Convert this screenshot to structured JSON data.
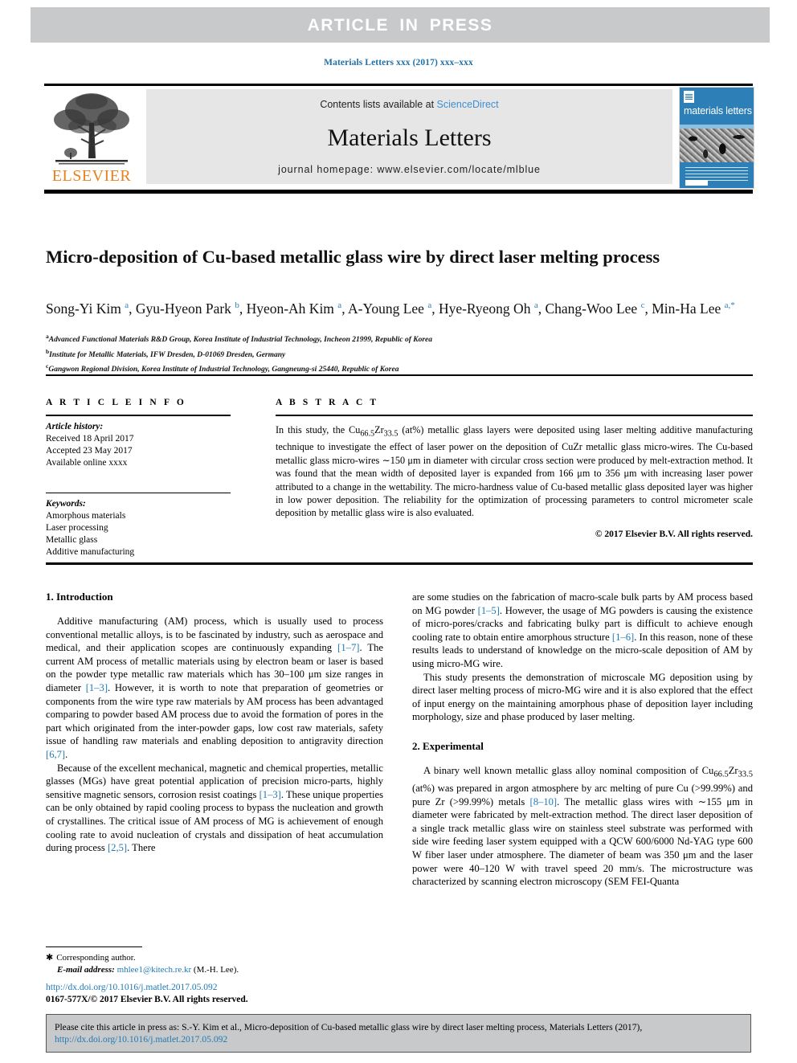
{
  "banner": {
    "text": "ARTICLE  IN  PRESS"
  },
  "running_head": {
    "text": "Materials Letters xxx (2017) xxx–xxx"
  },
  "masthead": {
    "contents_prefix": "Contents lists available at ",
    "sciencedirect": "ScienceDirect",
    "journal_name": "Materials Letters",
    "homepage": "journal homepage: www.elsevier.com/locate/mlblue",
    "publisher_wordmark": "ELSEVIER",
    "cover_title": "materials letters"
  },
  "article": {
    "title": "Micro-deposition of Cu-based metallic glass wire by direct laser melting process",
    "authors_html": "Song-Yi Kim <sup>a</sup>, Gyu-Hyeon Park <sup>b</sup>, Hyeon-Ah Kim <sup>a</sup>, A-Young Lee <sup>a</sup>, Hye-Ryeong Oh <sup>a</sup>, Chang-Woo Lee <sup>c</sup>, Min-Ha Lee <sup>a,*</sup>",
    "affiliations": [
      {
        "mark": "a",
        "text": "Advanced Functional Materials R&D Group, Korea Institute of Industrial Technology, Incheon 21999, Republic of Korea"
      },
      {
        "mark": "b",
        "text": "Institute for Metallic Materials, IFW Dresden, D-01069 Dresden, Germany"
      },
      {
        "mark": "c",
        "text": "Gangwon Regional Division, Korea Institute of Industrial Technology, Gangneung-si 25440, Republic of Korea"
      }
    ]
  },
  "info": {
    "heading": "A R T I C L E    I N F O",
    "history_label": "Article history:",
    "history": [
      "Received 18 April 2017",
      "Accepted 23 May 2017",
      "Available online xxxx"
    ],
    "keywords_label": "Keywords:",
    "keywords": [
      "Amorphous materials",
      "Laser processing",
      "Metallic glass",
      "Additive manufacturing"
    ]
  },
  "abstract": {
    "heading": "A B S T R A C T",
    "text_html": "In this study, the Cu<sub>66.5</sub>Zr<sub>33.5</sub> (at%) metallic glass layers were deposited using laser melting additive manufacturing technique to investigate the effect of laser power on the deposition of CuZr metallic glass micro-wires. The Cu-based metallic glass micro-wires &sim;150 &mu;m in diameter with circular cross section were produced by melt-extraction method. It was found that the mean width of deposited layer is expanded from 166 &mu;m to 356 &mu;m with increasing laser power attributed to a change in the wettability. The micro-hardness value of Cu-based metallic glass deposited layer was higher in low power deposition. The reliability for the optimization of processing parameters to control micrometer scale deposition by metallic glass wire is also evaluated.",
    "copyright": "© 2017 Elsevier B.V. All rights reserved."
  },
  "body": {
    "intro_heading": "1. Introduction",
    "experimental_heading": "2. Experimental",
    "left_paragraphs_html": [
      "Additive manufacturing (AM) process, which is usually used to process conventional metallic alloys, is to be fascinated by industry, such as aerospace and medical, and their application scopes are continuously expanding <span class=\"ref\">[1–7]</span>. The current AM process of metallic materials using by electron beam or laser is based on the powder type metallic raw materials which has 30–100 &mu;m size ranges in diameter <span class=\"ref\">[1–3]</span>. However, it is worth to note that preparation of geometries or components from the wire type raw materials by AM process has been advantaged comparing to powder based AM process due to avoid the formation of pores in the part which originated from the inter-powder gaps, low cost raw materials, safety issue of handling raw materials and enabling deposition to antigravity direction <span class=\"ref\">[6,7]</span>.",
      "Because of the excellent mechanical, magnetic and chemical properties, metallic glasses (MGs) have great potential application of precision micro-parts, highly sensitive magnetic sensors, corrosion resist coatings <span class=\"ref\">[1–3]</span>. These unique properties can be only obtained by rapid cooling process to bypass the nucleation and growth of crystallines. The critical issue of AM process of MG is achievement of enough cooling rate to avoid nucleation of crystals and dissipation of heat accumulation during process <span class=\"ref\">[2,5]</span>. There"
    ],
    "right_paragraphs_html": [
      "are some studies on the fabrication of macro-scale bulk parts by AM process based on MG powder <span class=\"ref\">[1–5]</span>. However, the usage of MG powders is causing the existence of micro-pores/cracks and fabricating bulky part is difficult to achieve enough cooling rate to obtain entire amorphous structure <span class=\"ref\">[1–6]</span>. In this reason, none of these results leads to understand of knowledge on the micro-scale deposition of AM by using micro-MG wire.",
      "This study presents the demonstration of microscale MG deposition using by direct laser melting process of micro-MG wire and it is also explored that the effect of input energy on the maintaining amorphous phase of deposition layer including morphology, size and phase produced by laser melting."
    ],
    "experimental_paragraph_html": "A binary well known metallic glass alloy nominal composition of Cu<sub>66.5</sub>Zr<sub>33.5</sub> (at%) was prepared in argon atmosphere by arc melting of pure Cu (>99.99%) and pure Zr (>99.99%) metals <span class=\"ref\">[8–10]</span>. The metallic glass wires with &sim;155 &mu;m in diameter were fabricated by melt-extraction method. The direct laser deposition of a single track metallic glass wire on stainless steel substrate was performed with side wire feeding laser system equipped with a QCW 600/6000 Nd-YAG type 600 W fiber laser under atmosphere. The diameter of beam was 350 &mu;m and the laser power were 40–120 W with travel speed 20 mm/s. The microstructure was characterized by scanning electron microscopy (SEM FEI-Quanta"
  },
  "footnote": {
    "corresponding": "Corresponding author.",
    "email_label": "E-mail address:",
    "email": "mhlee1@kitech.re.kr",
    "email_suffix": "(M.-H. Lee).",
    "doi_url": "http://dx.doi.org/10.1016/j.matlet.2017.05.092",
    "issn_line": "0167-577X/© 2017 Elsevier B.V. All rights reserved."
  },
  "cite_box": {
    "text": "Please cite this article in press as: S.-Y. Kim et al., Micro-deposition of Cu-based metallic glass wire by direct laser melting process, Materials Letters (2017),",
    "url": "http://dx.doi.org/10.1016/j.matlet.2017.05.092"
  }
}
